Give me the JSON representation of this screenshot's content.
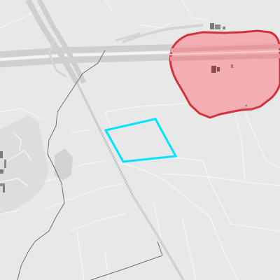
{
  "map": {
    "background_color": "#e8e8e8",
    "road_color": "#ffffff",
    "motorway_color": "#cfcfcf",
    "boundary_color": "#6e6e6e",
    "building_color": "#7a7a7a",
    "selection_outline_color": "#00e5ff",
    "highlight_area_fill": "#f3a3a8",
    "highlight_area_stroke": "#d1333d"
  }
}
